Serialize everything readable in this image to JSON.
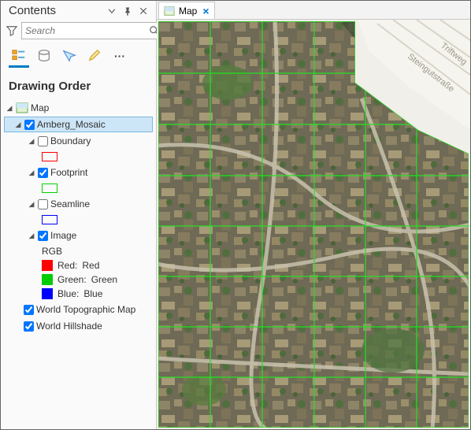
{
  "panel": {
    "title": "Contents",
    "searchPlaceholder": "Search",
    "sectionTitle": "Drawing Order"
  },
  "tree": {
    "root": {
      "label": "Map"
    },
    "mosaic": {
      "label": "Amberg_Mosaic",
      "checked": true,
      "selected": true
    },
    "sublayers": {
      "boundary": {
        "label": "Boundary",
        "checked": false,
        "swatchColor": "#ff0000"
      },
      "footprint": {
        "label": "Footprint",
        "checked": true,
        "swatchColor": "#00d400"
      },
      "seamline": {
        "label": "Seamline",
        "checked": false,
        "swatchColor": "#0000ff"
      },
      "image": {
        "label": "Image",
        "checked": true
      }
    },
    "rgb": {
      "title": "RGB",
      "bands": [
        {
          "label": "Red:",
          "value": "Red",
          "color": "#ff0000"
        },
        {
          "label": "Green:",
          "value": "Green",
          "color": "#00cc00"
        },
        {
          "label": "Blue:",
          "value": "Blue",
          "color": "#0000ff"
        }
      ]
    },
    "basemaps": {
      "topo": {
        "label": "World Topographic Map",
        "checked": true
      },
      "hillshade": {
        "label": "World Hillshade",
        "checked": true
      }
    }
  },
  "mapTab": {
    "label": "Map"
  },
  "mapLabels": {
    "street1": "Steingutstraße",
    "street2": "Triftweg"
  }
}
